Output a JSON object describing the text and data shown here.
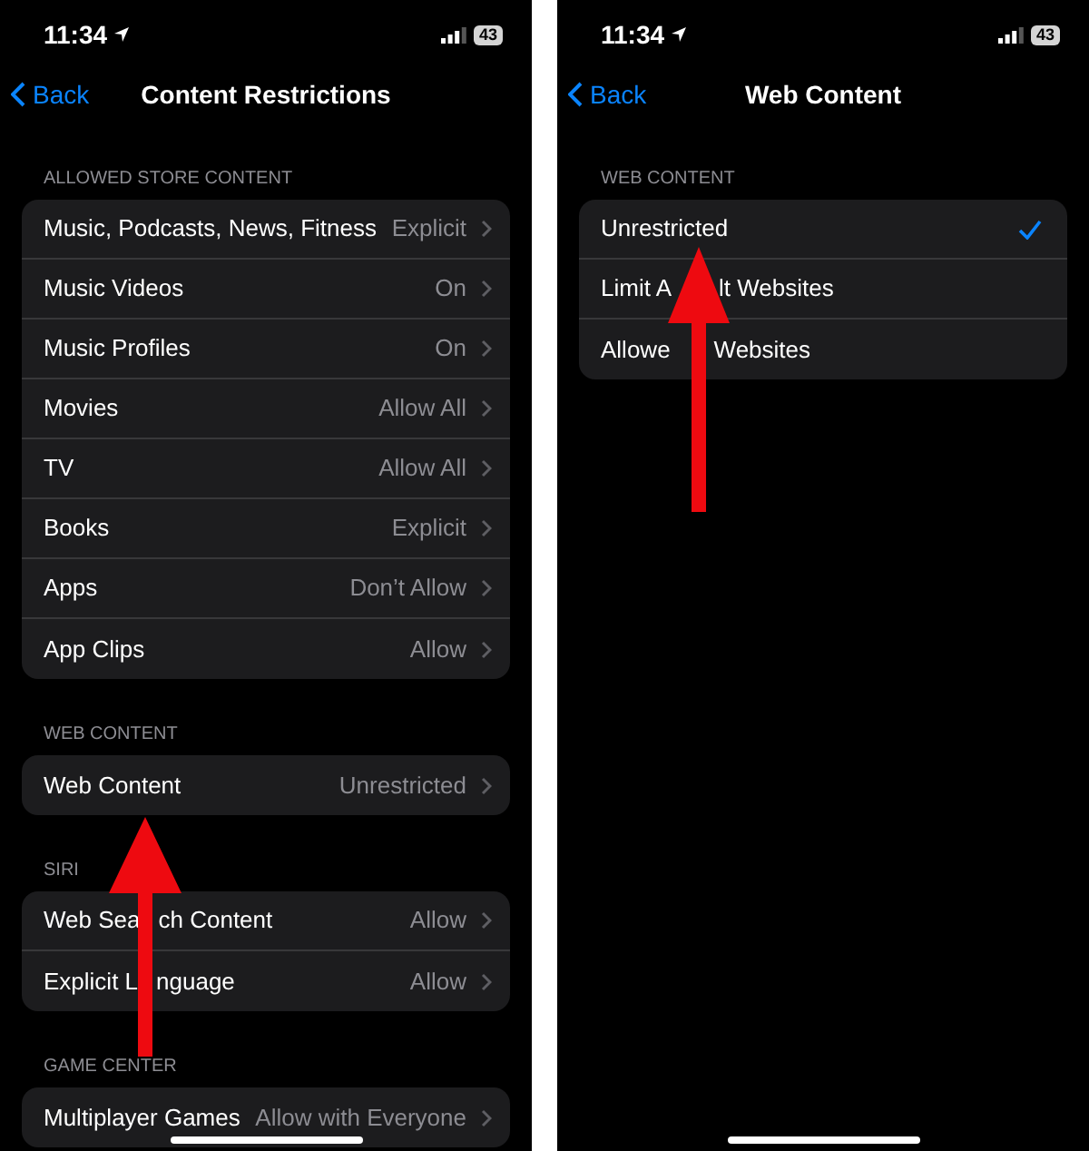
{
  "panels": [
    {
      "status_bar": {
        "time": "11:34",
        "battery": "43"
      },
      "nav": {
        "back": "Back",
        "title": "Content Restrictions"
      },
      "overlay": {
        "kind": "arrow"
      },
      "sections": [
        {
          "header": "ALLOWED STORE CONTENT",
          "rows": [
            {
              "kind": "disclosure",
              "label": "Music, Podcasts, News, Fitness",
              "value": "Explicit"
            },
            {
              "kind": "disclosure",
              "label": "Music Videos",
              "value": "On"
            },
            {
              "kind": "disclosure",
              "label": "Music Profiles",
              "value": "On"
            },
            {
              "kind": "disclosure",
              "label": "Movies",
              "value": "Allow All"
            },
            {
              "kind": "disclosure",
              "label": "TV",
              "value": "Allow All"
            },
            {
              "kind": "disclosure",
              "label": "Books",
              "value": "Explicit"
            },
            {
              "kind": "disclosure",
              "label": "Apps",
              "value": "Don’t Allow"
            },
            {
              "kind": "disclosure",
              "label": "App Clips",
              "value": "Allow"
            }
          ]
        },
        {
          "header": "WEB CONTENT",
          "rows": [
            {
              "kind": "disclosure",
              "label": "Web Content",
              "value": "Unrestricted"
            }
          ]
        },
        {
          "header": "SIRI",
          "rows": [
            {
              "kind": "disclosure",
              "label_parts": [
                "Web Sea",
                "ch Content"
              ],
              "value": "Allow"
            },
            {
              "kind": "disclosure",
              "label_parts": [
                "Explicit L",
                "nguage"
              ],
              "value": "Allow"
            }
          ]
        },
        {
          "header": "GAME CENTER",
          "rows": [
            {
              "kind": "disclosure",
              "label": "Multiplayer Games",
              "value": "Allow with Everyone"
            }
          ]
        }
      ]
    },
    {
      "status_bar": {
        "time": "11:34",
        "battery": "43"
      },
      "nav": {
        "back": "Back",
        "title": "Web Content"
      },
      "overlay": {
        "kind": "arrow"
      },
      "sections": [
        {
          "header": "WEB CONTENT",
          "rows": [
            {
              "kind": "choice",
              "label": "Unrestricted",
              "selected": true
            },
            {
              "kind": "choice",
              "label_parts": [
                "Limit A",
                "lt Websites"
              ],
              "selected": false
            },
            {
              "kind": "choice",
              "label_parts": [
                "Allowe",
                "Websites"
              ],
              "selected": false
            }
          ]
        }
      ]
    }
  ]
}
